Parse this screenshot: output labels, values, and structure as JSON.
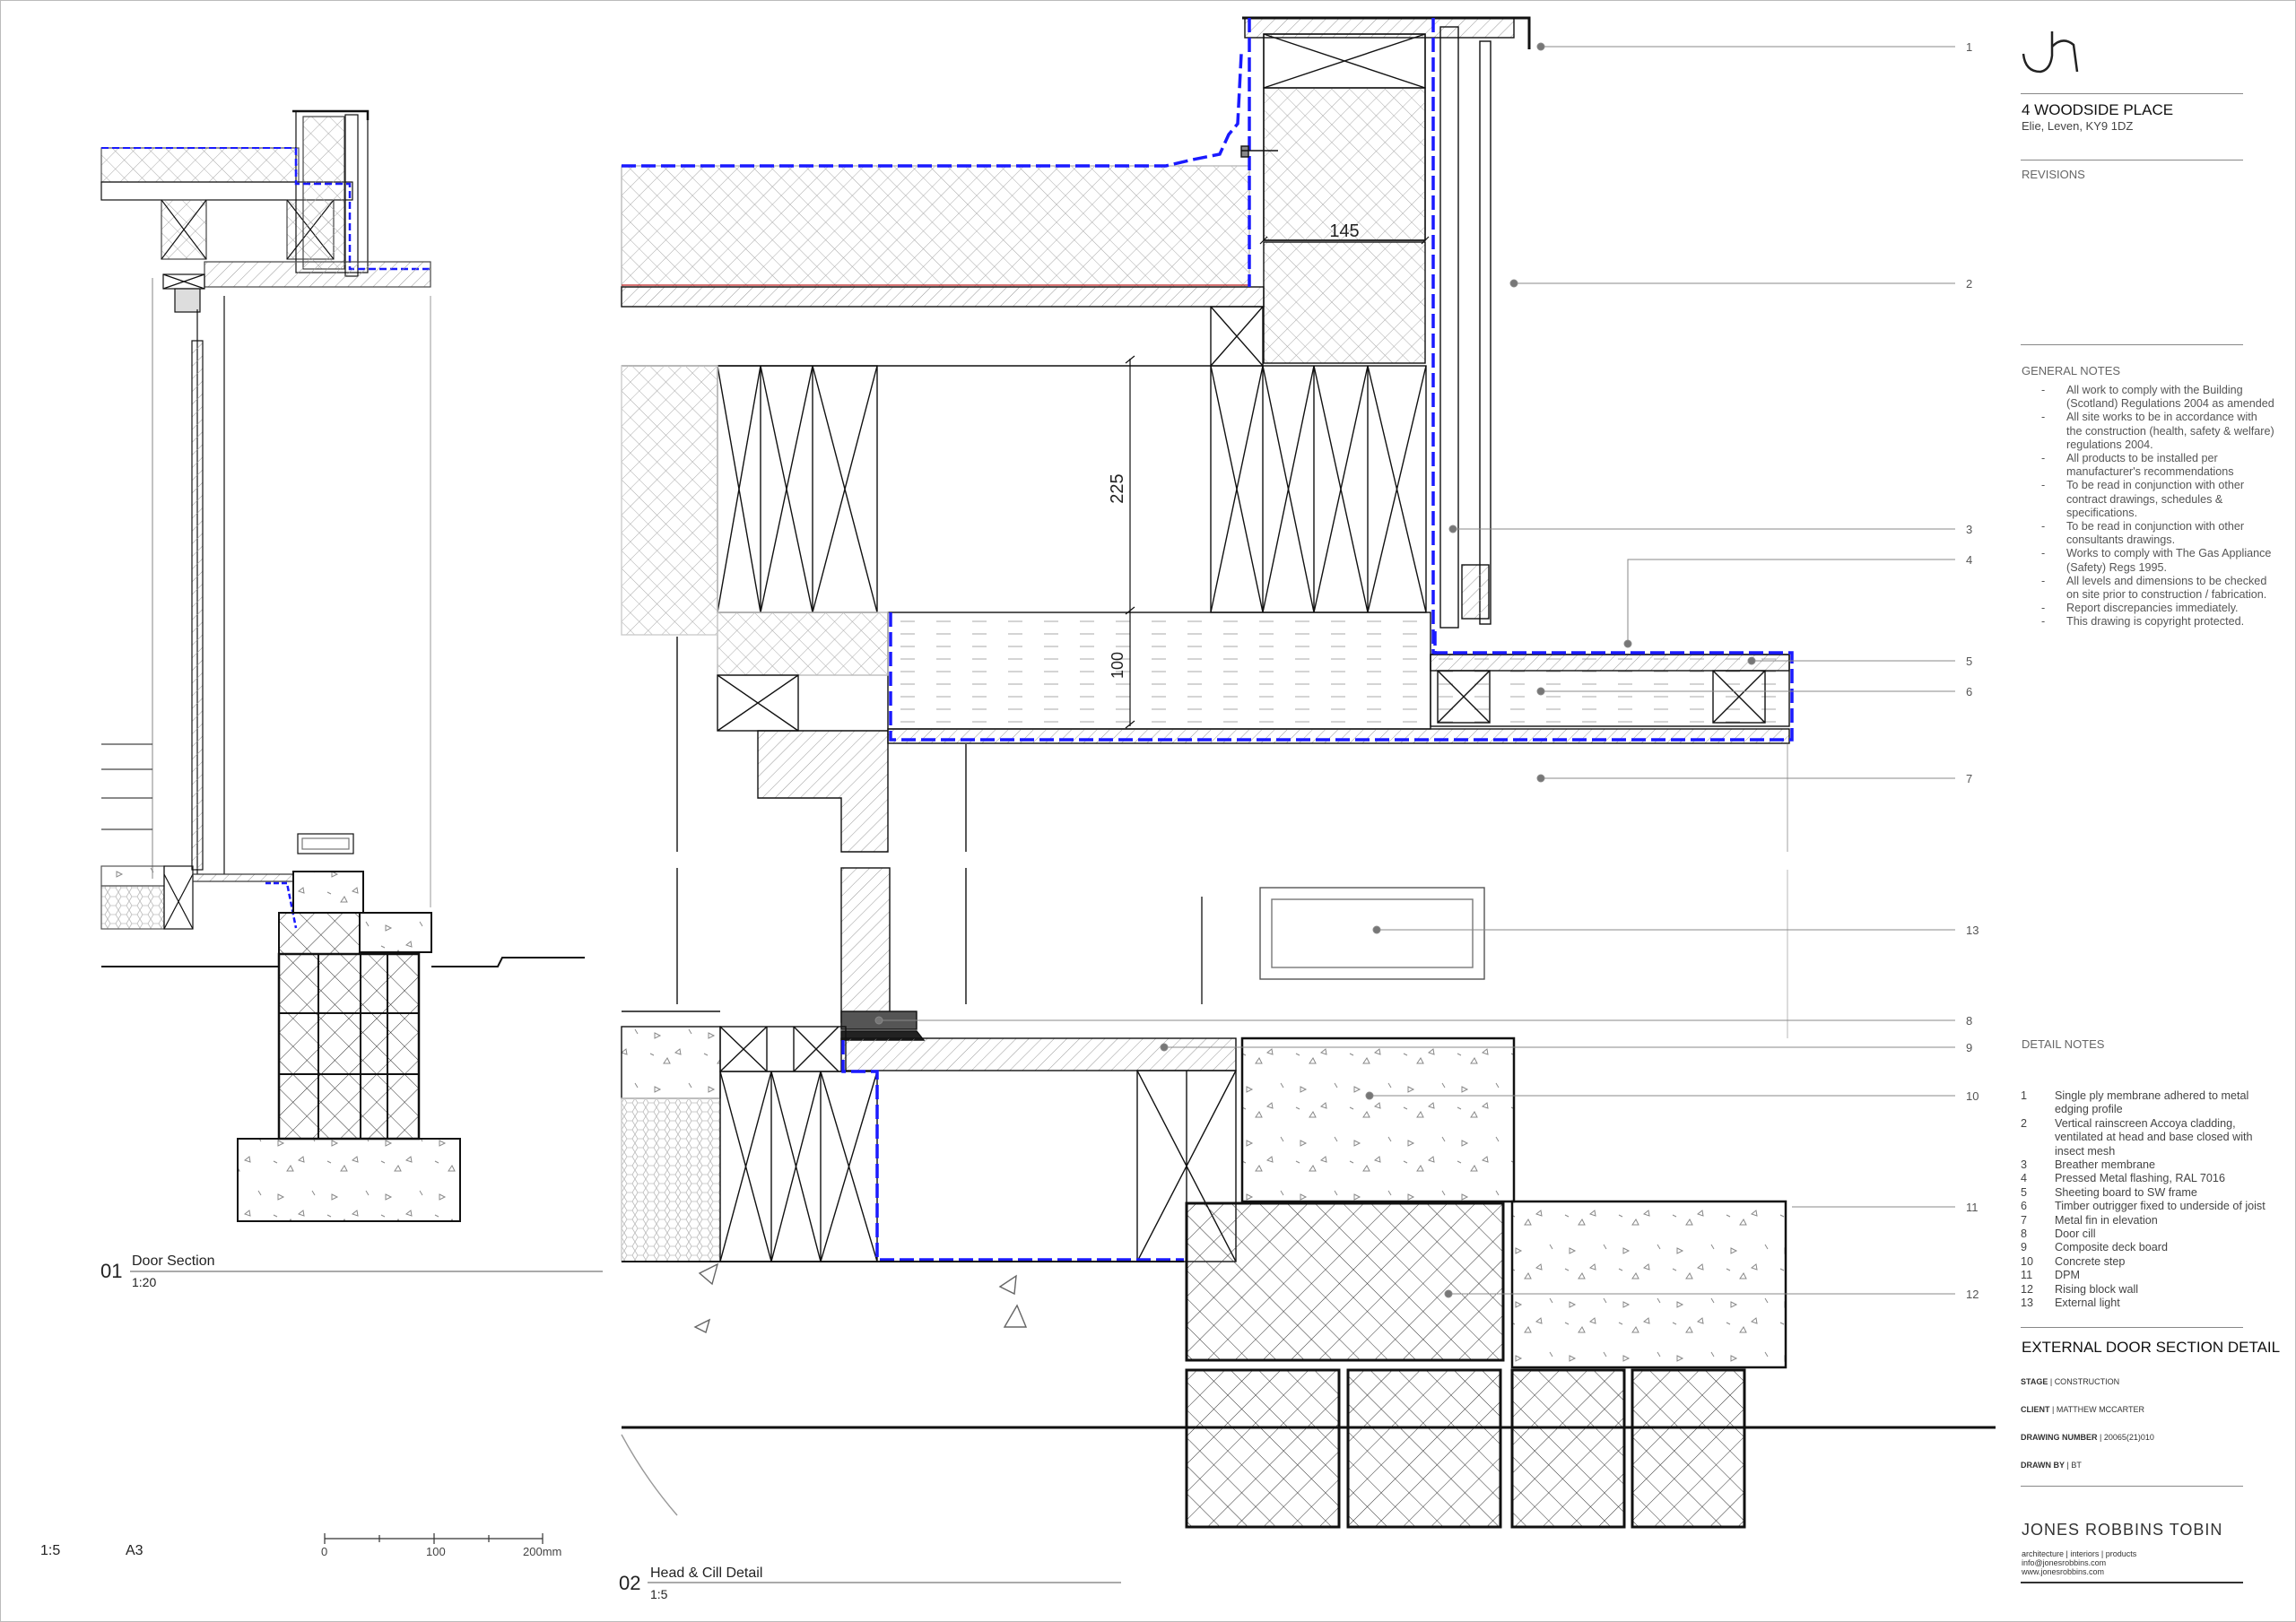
{
  "project": {
    "address_line1": "4 WOODSIDE PLACE",
    "address_line2": "Elie, Leven, KY9 1DZ"
  },
  "revisions_label": "REVISIONS",
  "general_notes": {
    "heading": "GENERAL NOTES",
    "items": [
      "All work to comply with the Building (Scotland) Regulations 2004 as amended",
      "All site works to be in accordance with the construction (health, safety & welfare) regulations 2004.",
      "All products to be installed per manufacturer's recommendations",
      "To be read in conjunction with other contract drawings, schedules & specifications.",
      "To be read in conjunction with other consultants drawings.",
      "Works to comply with The Gas Appliance (Safety) Regs 1995.",
      "All levels and dimensions to be checked on site prior to construction / fabrication.",
      "Report discrepancies immediately.",
      "This drawing is copyright protected."
    ]
  },
  "detail_notes": {
    "heading": "DETAIL  NOTES",
    "items": [
      {
        "num": "1",
        "text": "Single ply membrane adhered to metal edging profile"
      },
      {
        "num": "2",
        "text": "Vertical rainscreen Accoya cladding, ventilated at head and base closed with insect mesh"
      },
      {
        "num": "3",
        "text": "Breather membrane"
      },
      {
        "num": "4",
        "text": "Pressed Metal flashing, RAL 7016"
      },
      {
        "num": "5",
        "text": "Sheeting board to SW frame"
      },
      {
        "num": "6",
        "text": "Timber outrigger fixed to underside of joist"
      },
      {
        "num": "7",
        "text": "Metal fin in elevation"
      },
      {
        "num": "8",
        "text": "Door cill"
      },
      {
        "num": "9",
        "text": "Composite deck board"
      },
      {
        "num": "10",
        "text": "Concrete step"
      },
      {
        "num": "11",
        "text": "DPM"
      },
      {
        "num": "12",
        "text": "Rising block wall"
      },
      {
        "num": "13",
        "text": "External light"
      }
    ]
  },
  "title_block": {
    "drawing_title": "EXTERNAL DOOR SECTION DETAIL",
    "stage_label": "STAGE",
    "stage_value": "CONSTRUCTION",
    "client_label": "CLIENT",
    "client_value": "MATTHEW MCCARTER",
    "drawing_number_label": "DRAWING NUMBER",
    "drawing_number_value": "20065(21)010",
    "drawn_by_label": "DRAWN BY",
    "drawn_by_value": "BT",
    "firm_name": "JONES  ROBBINS  TOBIN",
    "firm_tagline": "architecture | interiors | products",
    "firm_email": "info@jonesrobbins.com",
    "firm_web": "www.jonesrobbins.com"
  },
  "sheet": {
    "scale": "1:5",
    "paper": "A3",
    "scale_bar_labels": [
      "0",
      "100",
      "200mm"
    ]
  },
  "views": [
    {
      "number": "01",
      "title": "Door Section",
      "scale": "1:20"
    },
    {
      "number": "02",
      "title": "Head & Cill Detail",
      "scale": "1:5"
    }
  ],
  "dimensions": {
    "head_insulation": "145",
    "lintel_depth": "225",
    "head_board": "100"
  },
  "callouts": [
    "1",
    "2",
    "3",
    "4",
    "5",
    "6",
    "7",
    "13",
    "8",
    "9",
    "10",
    "11",
    "12"
  ],
  "colors": {
    "membrane": "#1a1aff",
    "line": "#111111",
    "hatch": "#777777",
    "accent_red": "#c02020"
  },
  "icons": [
    "jrt-logo-icon"
  ]
}
